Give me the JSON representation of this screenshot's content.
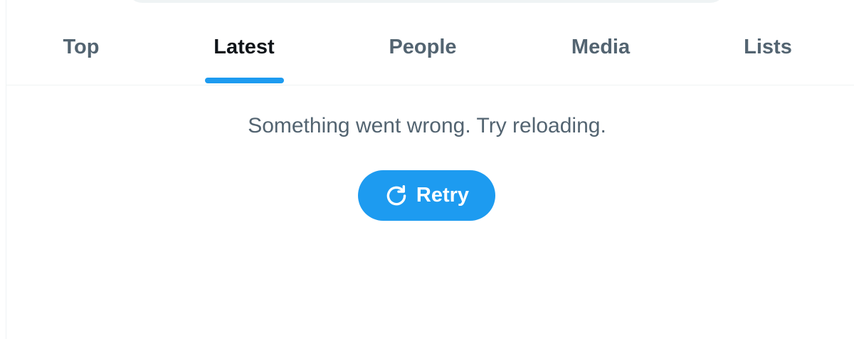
{
  "tabs": [
    {
      "label": "Top",
      "active": false
    },
    {
      "label": "Latest",
      "active": true
    },
    {
      "label": "People",
      "active": false
    },
    {
      "label": "Media",
      "active": false
    },
    {
      "label": "Lists",
      "active": false
    }
  ],
  "error": {
    "message": "Something went wrong. Try reloading.",
    "retry_label": "Retry",
    "retry_icon": "refresh-icon"
  },
  "colors": {
    "accent": "#1d9bf0",
    "text_primary": "#0f1419",
    "text_secondary": "#536471",
    "divider": "#eff3f4"
  }
}
